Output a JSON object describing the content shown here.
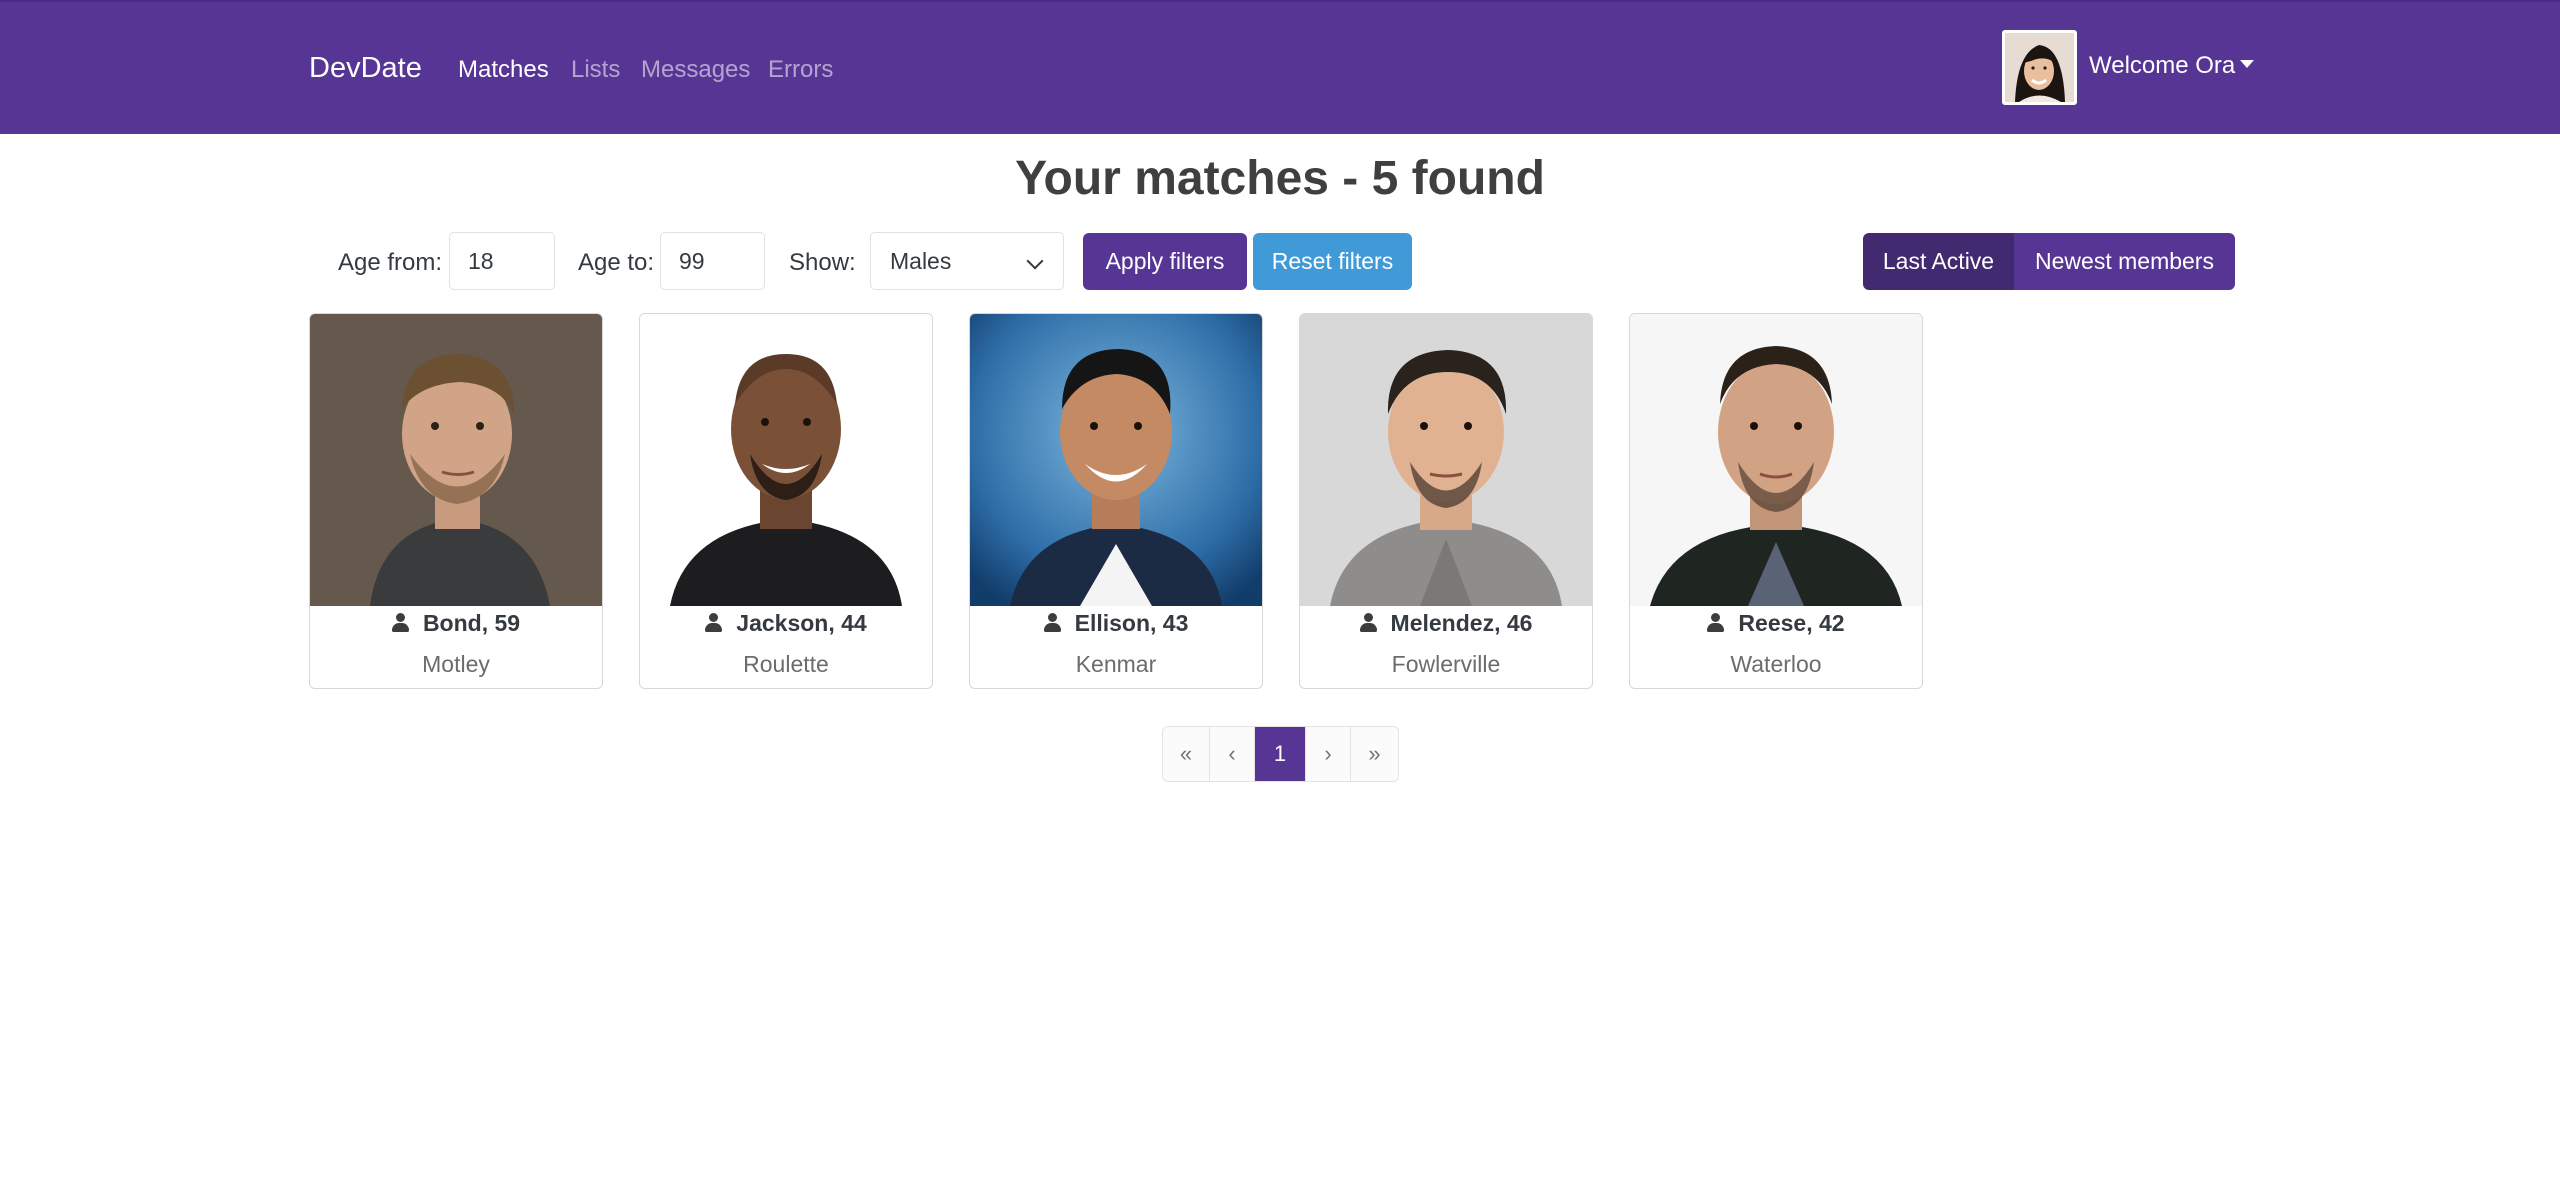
{
  "navbar": {
    "brand": "DevDate",
    "links": [
      "Matches",
      "Lists",
      "Messages",
      "Errors"
    ],
    "active_link": "Matches",
    "welcome": "Welcome Ora",
    "colors": {
      "background": "#563594",
      "active_text": "#ffffff",
      "inactive_text": "rgba(255,255,255,0.55)"
    }
  },
  "heading": "Your matches - 5 found",
  "filters": {
    "age_from_label": "Age from:",
    "age_from_value": "18",
    "age_to_label": "Age to:",
    "age_to_value": "99",
    "show_label": "Show:",
    "show_value": "Males",
    "apply_label": "Apply filters",
    "reset_label": "Reset filters"
  },
  "sort": {
    "last_active": "Last Active",
    "newest": "Newest members",
    "selected": "Last Active"
  },
  "members": [
    {
      "name_age": "Bond, 59",
      "city": "Motley"
    },
    {
      "name_age": "Jackson, 44",
      "city": "Roulette"
    },
    {
      "name_age": "Ellison, 43",
      "city": "Kenmar"
    },
    {
      "name_age": "Melendez, 46",
      "city": "Fowlerville"
    },
    {
      "name_age": "Reese, 42",
      "city": "Waterloo"
    }
  ],
  "pagination": {
    "first": "«",
    "prev": "‹",
    "current": "1",
    "next": "›",
    "last": "»"
  },
  "colors": {
    "primary": "#563594",
    "primary_dark": "#422a70",
    "info": "#3f9ad7"
  }
}
